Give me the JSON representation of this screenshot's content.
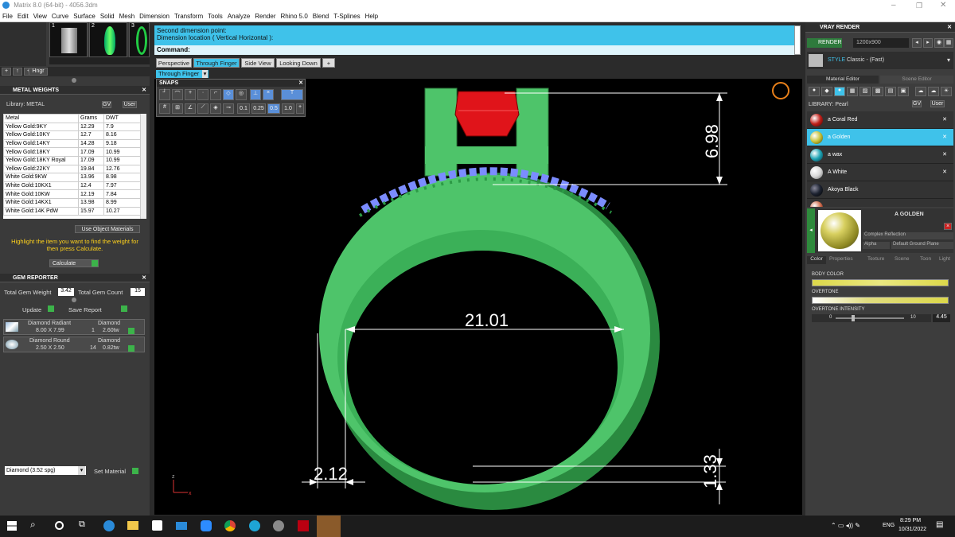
{
  "window": {
    "title": "Matrix 8.0 (64-bit) - 4056.3dm"
  },
  "menu": [
    "File",
    "Edit",
    "View",
    "Curve",
    "Surface",
    "Solid",
    "Mesh",
    "Dimension",
    "Transform",
    "Tools",
    "Analyze",
    "Render",
    "Rhino 5.0",
    "Blend",
    "T-Splines",
    "Help"
  ],
  "thumbnails": [
    {
      "num": "1"
    },
    {
      "num": "2"
    },
    {
      "num": "3"
    }
  ],
  "left_toolbar": {
    "hinge_label": "Hngr"
  },
  "metal_weights": {
    "title": "METAL WEIGHTS",
    "library_label": "Library: METAL",
    "gv_label": "GV",
    "user_label": "User",
    "columns": [
      "Metal",
      "Grams",
      "DWT"
    ],
    "rows": [
      [
        "Yellow Gold:9KY",
        "12.29",
        "7.9"
      ],
      [
        "Yellow Gold:10KY",
        "12.7",
        "8.16"
      ],
      [
        "Yellow Gold:14KY",
        "14.28",
        "9.18"
      ],
      [
        "Yellow Gold:18KY",
        "17.09",
        "10.99"
      ],
      [
        "Yellow Gold:18KY Royal",
        "17.09",
        "10.99"
      ],
      [
        "Yellow Gold:22KY",
        "19.84",
        "12.76"
      ],
      [
        "White Gold:9KW",
        "13.96",
        "8.98"
      ],
      [
        "White Gold:10KX1",
        "12.4",
        "7.97"
      ],
      [
        "White Gold:10KW",
        "12.19",
        "7.84"
      ],
      [
        "White Gold:14KX1",
        "13.98",
        "8.99"
      ],
      [
        "White Gold:14K PdW",
        "15.97",
        "10.27"
      ]
    ],
    "use_object_materials": "Use Object Materials",
    "hint": "Highlight the item you want to find the weight for then press Calculate.",
    "calculate_label": "Calculate"
  },
  "gem_reporter": {
    "title": "GEM REPORTER",
    "total_weight_label": "Total Gem Weight",
    "total_weight": "3.42",
    "total_count_label": "Total Gem Count",
    "total_count": "15",
    "update_label": "Update",
    "save_label": "Save Report",
    "gems": [
      {
        "name": "Diamond Radiant",
        "size": "8.00 X 7.99",
        "material": "Diamond",
        "qty": "1",
        "weight": "2.60tw"
      },
      {
        "name": "Diamond Round",
        "size": "2.50 X 2.50",
        "material": "Diamond",
        "qty": "14",
        "weight": "0.82tw"
      }
    ],
    "material_select": "Diamond    (3.52 spg)",
    "set_material_label": "Set Material"
  },
  "command": {
    "line1": "Second dimension point:",
    "line2": "Dimension location ( Vertical  Horizontal ):",
    "prompt": "Command:"
  },
  "viewport_tabs": [
    "Perspective",
    "Through Finger",
    "Side View",
    "Looking Down"
  ],
  "active_view": "Through Finger",
  "snaps": {
    "title": "SNAPS",
    "values": [
      "0.1",
      "0.25",
      "0.5",
      "1.0"
    ]
  },
  "dimensions": {
    "top_height": "6.98",
    "inner_diameter": "21.01",
    "band_width": "2.12",
    "bottom_thickness": "1.33"
  },
  "axis": {
    "z": "z",
    "x": "x"
  },
  "vray": {
    "title": "VRAY RENDER",
    "render_label": "RENDER",
    "resolution": "1200x900",
    "style_label": "STYLE",
    "style_value": "Classic - (Fast)",
    "tabs": [
      "Material Editor",
      "Scene Editor"
    ],
    "library_label": "LIBRARY: Pearl",
    "gv_label": "GV",
    "user_label": "User",
    "materials": [
      {
        "name": "a Coral Red",
        "color": "#c0201a"
      },
      {
        "name": "a Golden",
        "color": "#c8c23a"
      },
      {
        "name": "a wax",
        "color": "#1ea4b4"
      },
      {
        "name": "A White",
        "color": "#d8d8d8"
      },
      {
        "name": "Akoya Black",
        "color": "#1c2230"
      },
      {
        "name": "",
        "color": "#d07050"
      }
    ],
    "selected_name": "A GOLDEN",
    "complex_label": "Complex Reflection",
    "alpha_label": "Alpha",
    "ground_label": "Default Ground Plane",
    "sub_tabs": [
      "Color",
      "Properties",
      "Texture",
      "Scene",
      "Toon",
      "Light"
    ],
    "body_color_label": "BODY COLOR",
    "overtone_label": "OVERTONE",
    "intensity_label": "OVERTONE INTENSITY",
    "intensity_min": "0",
    "intensity_max": "10",
    "intensity_value": "4.45",
    "accent": "#3fc2ea"
  },
  "taskbar": {
    "lang": "ENG",
    "time": "8:29 PM",
    "date": "10/31/2022"
  }
}
